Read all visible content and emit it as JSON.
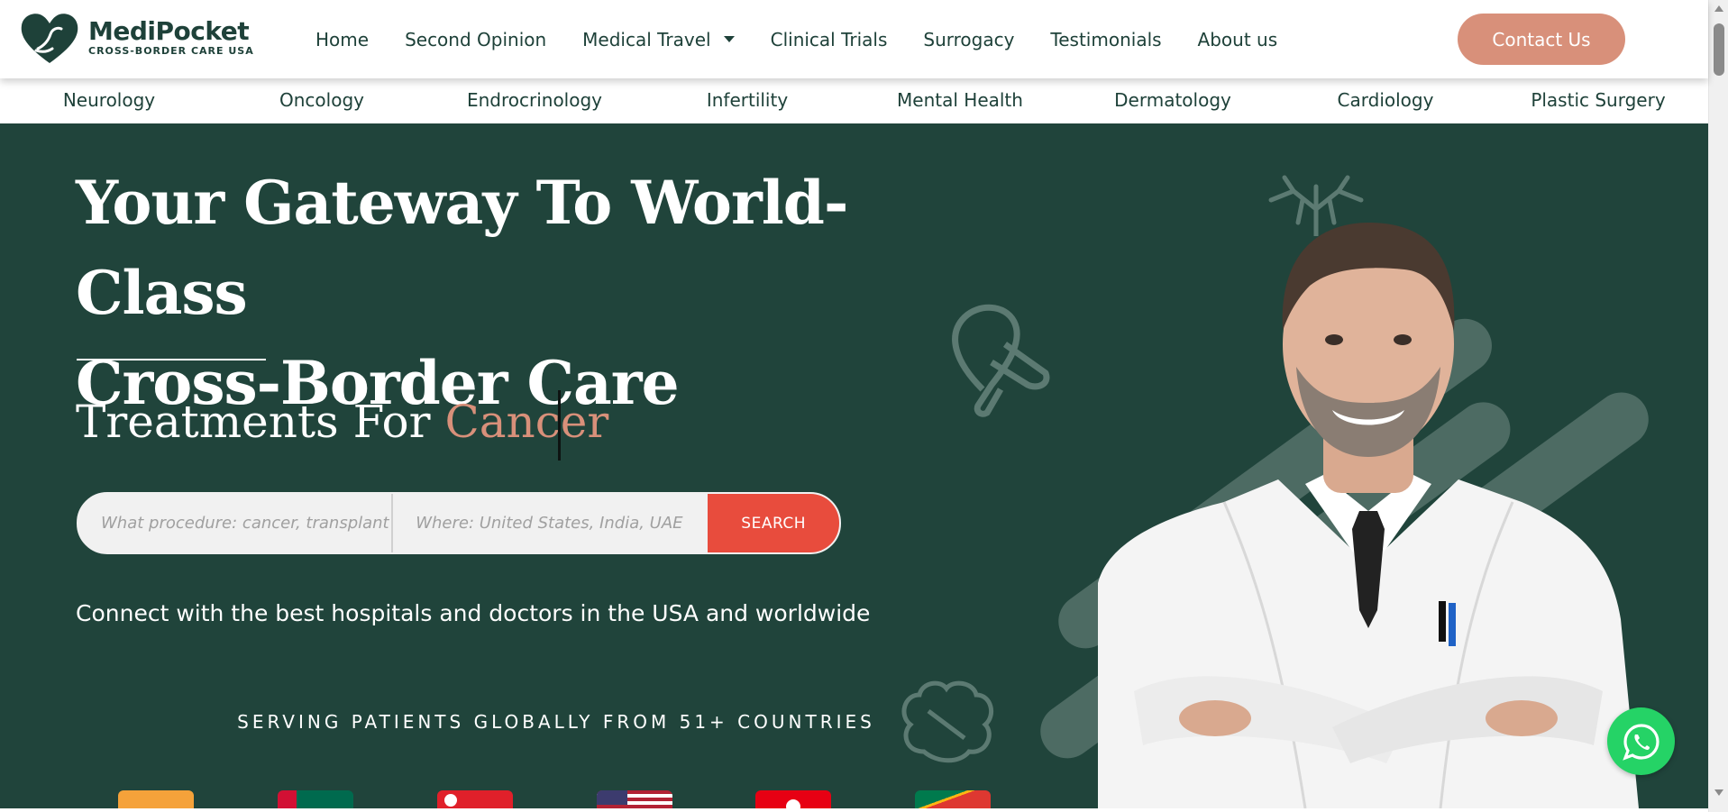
{
  "brand": {
    "name": "MediPocket",
    "tagline": "CROSS-BORDER CARE USA",
    "primary_color": "#20443b",
    "accent_color": "#d8907a",
    "search_button_color": "#e84c3d"
  },
  "nav": {
    "items": [
      {
        "label": "Home"
      },
      {
        "label": "Second Opinion"
      },
      {
        "label": "Medical Travel",
        "has_dropdown": true
      },
      {
        "label": "Clinical Trials"
      },
      {
        "label": "Surrogacy"
      },
      {
        "label": "Testimonials"
      },
      {
        "label": "About us"
      }
    ],
    "contact_label": "Contact Us"
  },
  "specialties": [
    "Neurology",
    "Oncology",
    "Endrocrinology",
    "Infertility",
    "Mental Health",
    "Dermatology",
    "Cardiology",
    "Plastic Surgery"
  ],
  "hero": {
    "title_line1": "Your Gateway To World-Class",
    "title_line2": "Cross-Border Care",
    "treatments_prefix": "Treatments For",
    "treatments_highlight": "Cancer",
    "search": {
      "procedure_placeholder": "What procedure: cancer, transplant",
      "location_placeholder": "Where: United States, India, UAE",
      "button_label": "SEARCH"
    },
    "subtitle": "Connect with the best hospitals and doctors in the USA and worldwide",
    "serving": "SERVING PATIENTS GLOBALLY FROM 51+ COUNTRIES"
  },
  "icons": [
    "logo-heart-hand-icon",
    "chevron-down-icon",
    "ribbon-icon",
    "brain-icon",
    "lungs-icon",
    "whatsapp-icon"
  ]
}
